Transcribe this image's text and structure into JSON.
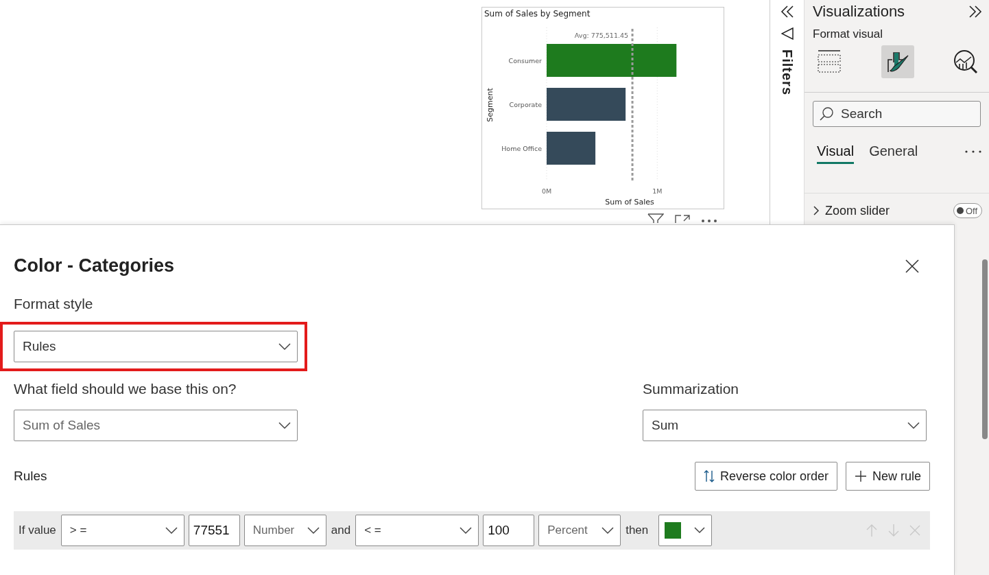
{
  "canvas": {
    "chart": {
      "title": "Sum of Sales by Segment",
      "chart_data": {
        "type": "bar",
        "orientation": "horizontal",
        "xlabel": "Sum of Sales",
        "ylabel": "Segment",
        "categories": [
          "Consumer",
          "Corporate",
          "Home Office"
        ],
        "series": [
          {
            "color": "#1e7b1e",
            "values": [
              1174000,
              null,
              null
            ]
          },
          {
            "color": "#354a5a",
            "values": [
              null,
              714000,
              441000
            ]
          }
        ],
        "xticks": [
          {
            "value": 0,
            "label": "0M"
          },
          {
            "value": 1000000,
            "label": "1M"
          }
        ],
        "xlim": [
          0,
          1600000
        ],
        "ref_lines": [
          {
            "axis": "x",
            "value": 775511.45,
            "label": "Avg: 775,511.45"
          }
        ]
      }
    }
  },
  "filters_pane": {
    "label": "Filters"
  },
  "visualizations_pane": {
    "title": "Visualizations",
    "subtitle": "Format visual",
    "view_buttons": [
      {
        "kind": "fields",
        "selected": false
      },
      {
        "kind": "format",
        "selected": true
      },
      {
        "kind": "analytics",
        "selected": false
      }
    ],
    "search": {
      "placeholder": "Search"
    },
    "tabs": [
      {
        "label": "Visual",
        "selected": true
      },
      {
        "label": "General",
        "selected": false
      }
    ],
    "section": {
      "label": "Zoom slider",
      "toggle": {
        "on": false,
        "label": "Off"
      }
    }
  },
  "dialog": {
    "title": "Color - Categories",
    "format_style": {
      "label": "Format style",
      "value": "Rules",
      "highlighted": true
    },
    "base_field": {
      "label": "What field should we base this on?",
      "value": "Sum of Sales"
    },
    "summarization": {
      "label": "Summarization",
      "value": "Sum"
    },
    "rules_label": "Rules",
    "buttons": [
      {
        "kind": "reverse",
        "label": "Reverse color order"
      },
      {
        "kind": "add",
        "label": "New rule"
      }
    ],
    "rules": [
      {
        "prefix": "If value",
        "operator_1": "> =",
        "value_1": "77551",
        "type_1": "Number",
        "conjunction": "and",
        "operator_2": "< =",
        "value_2": "100",
        "type_2": "Percent",
        "suffix": "then",
        "color": "#1e7b1e"
      }
    ]
  }
}
